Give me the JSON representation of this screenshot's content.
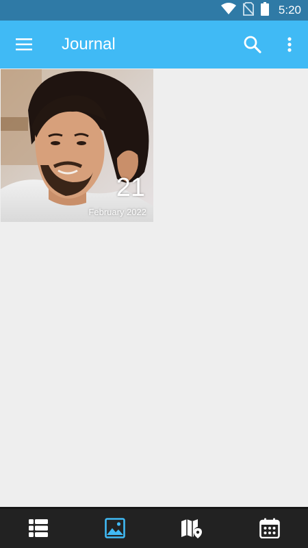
{
  "status_bar": {
    "time": "5:20",
    "icons": [
      "wifi-icon",
      "no-sim-icon",
      "battery-icon"
    ]
  },
  "app_bar": {
    "title": "Journal",
    "icons": [
      "menu-icon",
      "search-icon",
      "more-vert-icon"
    ],
    "color": "#40baf5"
  },
  "entries": [
    {
      "day": "21",
      "month_year": "February 2022",
      "image": "photo of a smiling man with long curly dark hair"
    }
  ],
  "bottom_nav": {
    "items": [
      {
        "icon": "list-icon",
        "selected": false
      },
      {
        "icon": "image-icon",
        "selected": true
      },
      {
        "icon": "map-icon",
        "selected": false
      },
      {
        "icon": "calendar-icon",
        "selected": false
      }
    ],
    "selected_color": "#40baf5",
    "color": "#ffffff"
  }
}
